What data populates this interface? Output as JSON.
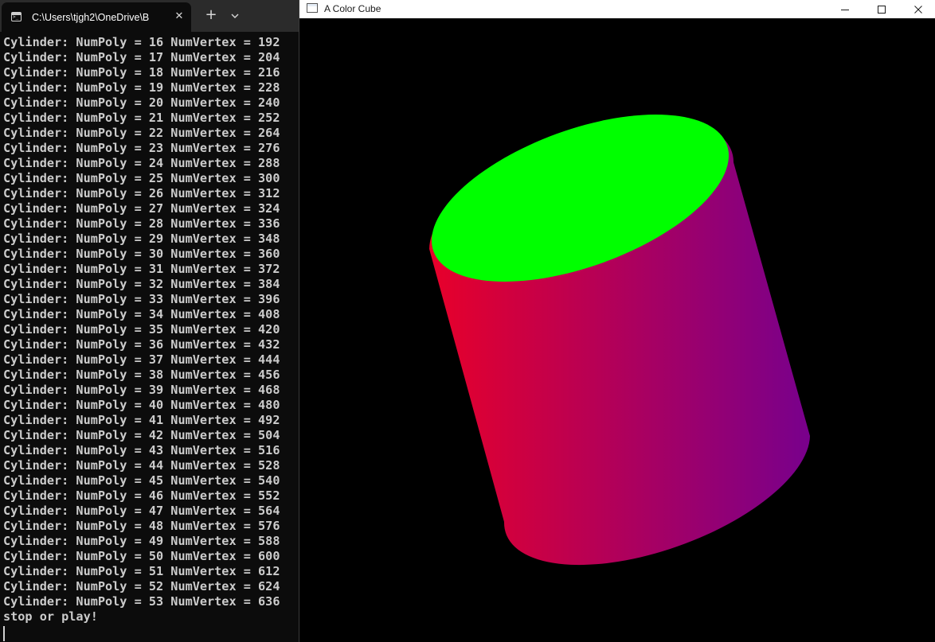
{
  "terminal": {
    "tab_title": "C:\\Users\\tjgh2\\OneDrive\\B",
    "close_glyph": "✕",
    "new_tab_glyph": "+",
    "lines": [
      "Cylinder: NumPoly = 16 NumVertex = 192",
      "Cylinder: NumPoly = 17 NumVertex = 204",
      "Cylinder: NumPoly = 18 NumVertex = 216",
      "Cylinder: NumPoly = 19 NumVertex = 228",
      "Cylinder: NumPoly = 20 NumVertex = 240",
      "Cylinder: NumPoly = 21 NumVertex = 252",
      "Cylinder: NumPoly = 22 NumVertex = 264",
      "Cylinder: NumPoly = 23 NumVertex = 276",
      "Cylinder: NumPoly = 24 NumVertex = 288",
      "Cylinder: NumPoly = 25 NumVertex = 300",
      "Cylinder: NumPoly = 26 NumVertex = 312",
      "Cylinder: NumPoly = 27 NumVertex = 324",
      "Cylinder: NumPoly = 28 NumVertex = 336",
      "Cylinder: NumPoly = 29 NumVertex = 348",
      "Cylinder: NumPoly = 30 NumVertex = 360",
      "Cylinder: NumPoly = 31 NumVertex = 372",
      "Cylinder: NumPoly = 32 NumVertex = 384",
      "Cylinder: NumPoly = 33 NumVertex = 396",
      "Cylinder: NumPoly = 34 NumVertex = 408",
      "Cylinder: NumPoly = 35 NumVertex = 420",
      "Cylinder: NumPoly = 36 NumVertex = 432",
      "Cylinder: NumPoly = 37 NumVertex = 444",
      "Cylinder: NumPoly = 38 NumVertex = 456",
      "Cylinder: NumPoly = 39 NumVertex = 468",
      "Cylinder: NumPoly = 40 NumVertex = 480",
      "Cylinder: NumPoly = 41 NumVertex = 492",
      "Cylinder: NumPoly = 42 NumVertex = 504",
      "Cylinder: NumPoly = 43 NumVertex = 516",
      "Cylinder: NumPoly = 44 NumVertex = 528",
      "Cylinder: NumPoly = 45 NumVertex = 540",
      "Cylinder: NumPoly = 46 NumVertex = 552",
      "Cylinder: NumPoly = 47 NumVertex = 564",
      "Cylinder: NumPoly = 48 NumVertex = 576",
      "Cylinder: NumPoly = 49 NumVertex = 588",
      "Cylinder: NumPoly = 50 NumVertex = 600",
      "Cylinder: NumPoly = 51 NumVertex = 612",
      "Cylinder: NumPoly = 52 NumVertex = 624",
      "Cylinder: NumPoly = 53 NumVertex = 636",
      "stop or play!"
    ],
    "colors": {
      "background": "#0c0c0c",
      "text": "#cccccc",
      "tabbar": "#2b2b2b"
    }
  },
  "gl_window": {
    "title": "A Color Cube",
    "colors": {
      "background": "#000000",
      "cylinder_top": "#00ff00",
      "cylinder_side_left": "#e8002a",
      "cylinder_side_right": "#78008c"
    }
  }
}
